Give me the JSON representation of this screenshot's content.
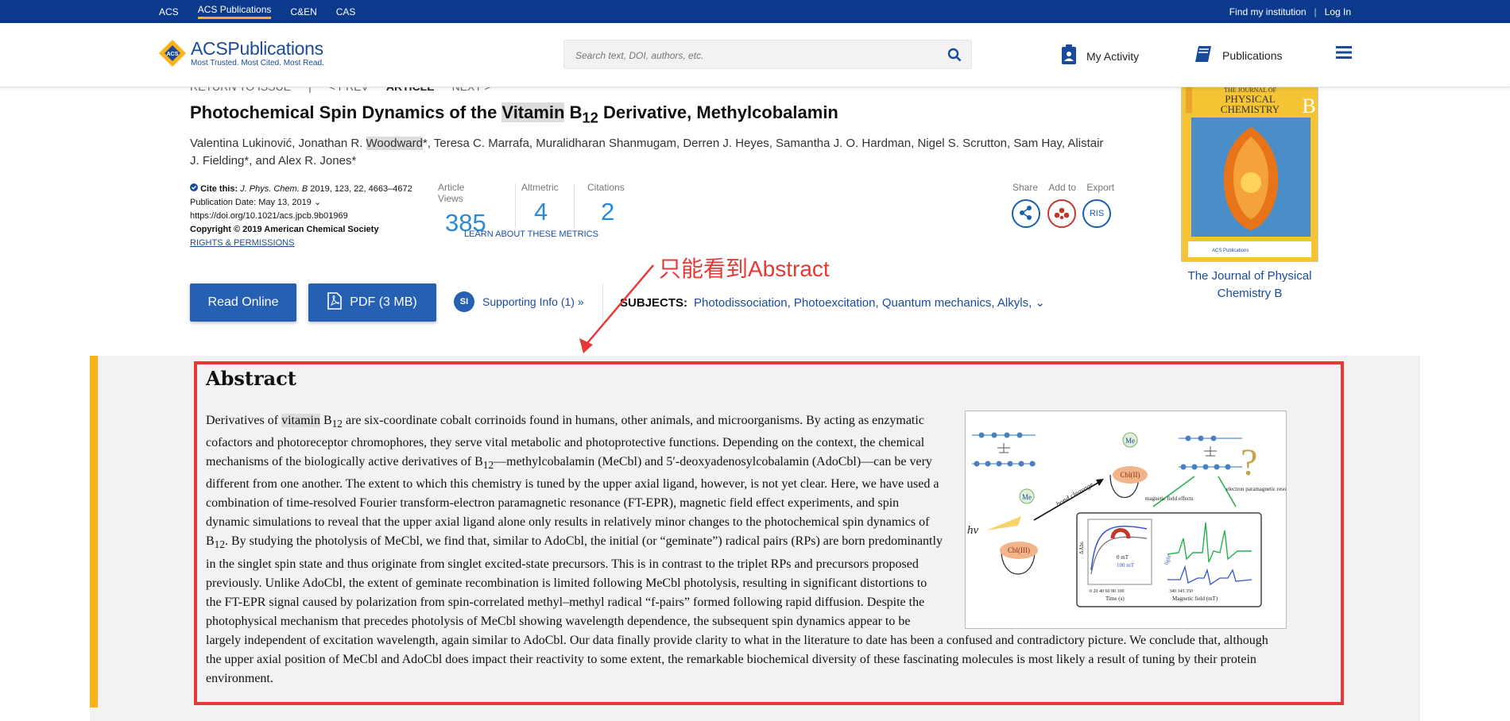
{
  "topnav": {
    "left": [
      "ACS",
      "ACS Publications",
      "C&EN",
      "CAS"
    ],
    "active": "ACS Publications",
    "find_institution": "Find my institution",
    "separator": "|",
    "login": "Log In"
  },
  "header": {
    "logo_title_acs": "ACS",
    "logo_title_pub": "Publications",
    "logo_subtitle": "Most Trusted. Most Cited. Most Read.",
    "search_placeholder": "Search text, DOI, authors, etc.",
    "my_activity": "My Activity",
    "publications": "Publications"
  },
  "pager": {
    "return": "RETURN TO ISSUE",
    "sep": "|",
    "prev": "< PREV",
    "article": "ARTICLE",
    "next": "NEXT >"
  },
  "article": {
    "title_part1": "Photochemical Spin Dynamics of the ",
    "title_highlight": "Vitamin",
    "title_part2": " B",
    "title_sub": "12",
    "title_part3": " Derivative, Methylcobalamin",
    "authors_part1": "Valentina Lukinović, Jonathan R. ",
    "authors_highlight": "Woodward",
    "authors_part2": "*, Teresa C. Marrafa, Muralidharan Shanmugam, Derren J. Heyes, Samantha J. O. Hardman, Nigel S. Scrutton, Sam Hay, Alistair J. Fielding*, and Alex R. Jones*"
  },
  "cite": {
    "label": "Cite this:",
    "journal": "J. Phys. Chem. B",
    "ref": "2019, 123, 22, 4663–4672",
    "pub_date": "Publication Date: May 13, 2019",
    "doi": "https://doi.org/10.1021/acs.jpcb.9b01969",
    "copyright": "Copyright © 2019 American Chemical Society",
    "rights": "RIGHTS & PERMISSIONS"
  },
  "metrics": {
    "views_label": "Article Views",
    "views": "385",
    "altmetric_label": "Altmetric",
    "altmetric": "4",
    "citations_label": "Citations",
    "citations": "2",
    "learn": "LEARN ABOUT THESE METRICS"
  },
  "share_bar": {
    "share": "Share",
    "add_to": "Add to",
    "export": "Export",
    "ris": "RIS"
  },
  "cover": {
    "journal_line1": "THE JOURNAL OF",
    "journal_line2": "PHYSICAL",
    "journal_line3": "CHEMISTRY",
    "letter": "B",
    "caption": "The Journal of Physical Chemistry B"
  },
  "actions": {
    "read_online": "Read Online",
    "pdf": "PDF (3 MB)",
    "si_badge": "SI",
    "supporting": "Supporting Info (1) »",
    "subjects_label": "SUBJECTS:",
    "subjects": "Photodissociation, Photoexcitation, Quantum mechanics, Alkyls,"
  },
  "annotation": "只能看到Abstract",
  "abstract": {
    "title": "Abstract",
    "t1": "Derivatives of ",
    "t1_hl": "vitamin",
    "t2": " B",
    "t2_sub": "12",
    "t3": " are six-coordinate cobalt corrinoids found in humans, other animals, and microorganisms. By acting as enzymatic cofactors and photoreceptor chromophores, they serve vital metabolic and photoprotective functions. Depending on the context, the chemical mechanisms of the biologically active derivatives of B",
    "t3_sub": "12",
    "t4": "—methylcobalamin (MeCbl) and 5′-deoxyadenosylcobalamin (AdoCbl)—can be very different from one another. The extent to which this chemistry is tuned by the upper axial ligand, however, is not yet clear. Here, we have used a combination of time-resolved Fourier transform-electron paramagnetic resonance (FT-EPR), magnetic field effect experiments, and spin dynamic simulations to reveal that the upper axial ligand alone only results in relatively minor changes to the photochemical spin dynamics of B",
    "t4_sub": "12",
    "t5": ". By studying the photolysis of MeCbl, we find that, similar to AdoCbl, the initial (or “geminate”) radical pairs (RPs) are born predominantly in the singlet spin state and thus originate from singlet excited-state precursors. This is in contrast to the triplet RPs and precursors proposed previously. Unlike AdoCbl, the extent of geminate recombination is limited following MeCbl photolysis, resulting in significant distortions to the FT-EPR signal caused by polarization from spin-correlated methyl–methyl radical “f-pairs” formed following rapid diffusion. Despite the photophysical mechanism that precedes photolysis of MeCbl showing wavelength dependence, the subsequent spin dynamics appear to be largely independent of excitation wavelength, again similar to AdoCbl. Our data finally provide clarity to what in the literature to date has been a confused and contradictory picture. We conclude that, although the upper axial position of MeCbl and AdoCbl does impact their reactivity to some extent, the remarkable biochemical diversity of these fascinating molecules is most likely a result of tuning by their protein environment."
  },
  "toc_graphic": {
    "me1": "Me",
    "me2": "Me",
    "cbl_ii": "Cbl(II)",
    "cbl_iii": "Cbl(III)",
    "bond": "bond cleavage",
    "hv": "hv",
    "mfe": "magnetic field effects",
    "epr": "electron paramagnetic resonance",
    "question": "?",
    "legend0": "0 mT",
    "legend100": "100 mT",
    "xaxis1": "Time (s)",
    "xaxis1_ticks": "0  20  40  60  80 100",
    "xaxis2": "Magnetic field (mT)",
    "xaxis2_ticks": "340    345    350",
    "yaxis1": "ΔAbs",
    "light": "light"
  },
  "colors": {
    "topbar": "#0b3a8d",
    "brand": "#1a4b9b",
    "accent": "#fbb117",
    "metric": "#2b8ad6",
    "annotation": "#e53935",
    "button": "#2660b3"
  }
}
